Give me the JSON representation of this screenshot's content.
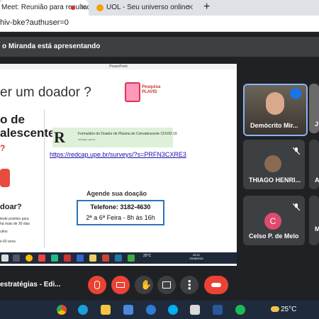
{
  "browser": {
    "tab1_title": "Meet: Reunião para resultad",
    "tab2_title": "UOL - Seu universo online",
    "new_tab": "+",
    "url": "hiv-bke?authuser=0"
  },
  "presenter_banner": "o Miranda está apresentando",
  "shared_screen": {
    "app_title": "PowerPoint",
    "slide": {
      "title": "er um doador ?",
      "logo_text": "Pesquisa PLAVID",
      "left_line1": "o de",
      "left_line2": "alescente",
      "red_q": "?",
      "doar": "doar?",
      "left_small1": "teste positivo para",
      "left_small2": "há mais de 30 dias",
      "left_small3": "ulino",
      "left_small4": "e 60 anos",
      "form_title": "Formulário do Doador de Plasma de Convalescente COVID-19",
      "form_sub": "redcap.upe.br",
      "link": "https://redcap.upe.br/surveys/?s=PRFN3CXRE3",
      "agende": "Agende sua doação",
      "phone": "Telefone: 3182-4630",
      "hours": "2ª a 6ª Feira - 8h às 16h"
    },
    "inner_taskbar": {
      "weather": "25°C",
      "clock_time": "09:21",
      "clock_date": "13/08/2021"
    }
  },
  "participants": [
    {
      "name": "Demócrito Mir...",
      "speaking": true
    },
    {
      "name": "J",
      "speaking": false
    },
    {
      "name": "THIAGO HENRI...",
      "muted": true
    },
    {
      "name": "A",
      "muted": true
    },
    {
      "name": "Celso P. de Melo",
      "initial": "C",
      "muted": true
    },
    {
      "name": "M",
      "muted": false
    }
  ],
  "controls": {
    "meeting_name": "estratégias - Edi...",
    "mic": "mic-off",
    "camera": "camera-off",
    "raise_hand": "raise-hand",
    "present": "present-screen",
    "more": "more-options",
    "hangup": "hang-up"
  },
  "taskbar": {
    "weather": "25°C"
  },
  "colors": {
    "meet_bg": "#202124",
    "tile_bg": "#3c4043",
    "hangup_red": "#ea4335",
    "speaking_blue": "#8ab4f8",
    "avatar_pink": "#e04a6f"
  }
}
